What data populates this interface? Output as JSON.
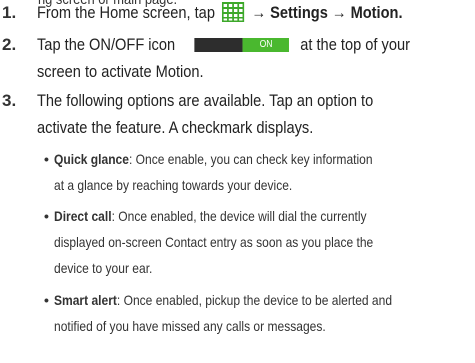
{
  "cut_top_line": "ng screen or main page.",
  "steps": [
    {
      "number": "1.",
      "lines": [
        {
          "before": "From the Home screen, tap",
          "after": "→ Settings → Motion."
        }
      ]
    },
    {
      "number": "2.",
      "lines": [
        {
          "before": "Tap the ON/OFF icon",
          "after": "at the top of your"
        },
        {
          "text": "screen to activate Motion."
        }
      ]
    },
    {
      "number": "3.",
      "lines": [
        {
          "text": "The following options are available. Tap an option to"
        },
        {
          "text": "activate the feature. A checkmark displays."
        }
      ]
    }
  ],
  "toggle": {
    "on_label": "ON"
  },
  "apps_icon": "apps-grid-icon",
  "bullets": [
    {
      "term": "Quick glance",
      "first_line_rest": ":  Once enable, you can check key information",
      "more_lines": [
        "at a glance by reaching towards your device."
      ]
    },
    {
      "term": "Direct call",
      "first_line_rest": ": Once enabled, the device will dial the currently",
      "more_lines": [
        "displayed on-screen Contact entry as soon as you place the",
        "device to your ear."
      ]
    },
    {
      "term": "Smart alert",
      "first_line_rest": ": Once enabled, pickup the device to be alerted and",
      "more_lines": [
        "notified of you have missed any calls or messages."
      ]
    }
  ],
  "bullet_symbol": "•",
  "colors": {
    "text": "#222222",
    "apps_icon": "#3da82a",
    "toggle_off": "#2d2d2d",
    "toggle_on": "#4ab82f"
  }
}
